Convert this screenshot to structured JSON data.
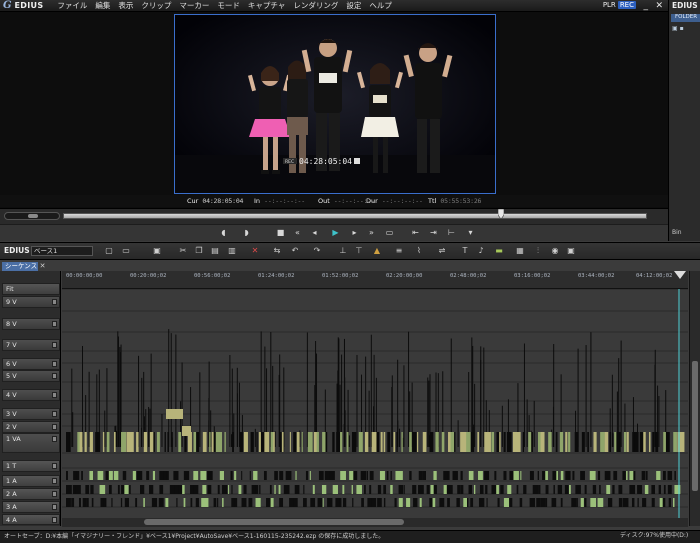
{
  "app": {
    "brand": "EDIUS",
    "logo_mark": "G"
  },
  "menu": [
    "ファイル",
    "編集",
    "表示",
    "クリップ",
    "マーカー",
    "モード",
    "キャプチャ",
    "レンダリング",
    "設定",
    "ヘルプ"
  ],
  "mode": {
    "plr": "PLR",
    "rec": "REC"
  },
  "window_controls": {
    "minimize": "_",
    "close": "✕"
  },
  "video_overlay": {
    "rec_label": "REC",
    "timecode": "04:28:05:04"
  },
  "timecodes": {
    "cur_label": "Cur",
    "cur_value": "04:28:05:04",
    "in_label": "In",
    "in_value": "--:--:--:--",
    "out_label": "Out",
    "out_value": "--:--:--:--",
    "dur_label": "Dur",
    "dur_value": "--:--:--:--",
    "ttl_label": "Ttl",
    "ttl_value": "05:55:53:26"
  },
  "bin": {
    "title": "EDIUS",
    "tab": "FOLDER",
    "bin_label": "Bin"
  },
  "timeline": {
    "brand": "EDIUS",
    "sequence_name": "ベース1",
    "sequence_tab": "シーケンス1",
    "ruler": [
      "00:00:00;00",
      "00:20:00;02",
      "00:56:00;02",
      "01:24:00;02",
      "01:52:00;02",
      "02:20:00;00",
      "02:48:00;02",
      "03:16:00;02",
      "03:44:00;02",
      "04:12:00;02"
    ],
    "track_headers": [
      {
        "label": "Fit",
        "kind": "zoom"
      },
      {
        "label": "9 V"
      },
      {
        "label": "8 V"
      },
      {
        "label": "7 V"
      },
      {
        "label": "6 V"
      },
      {
        "label": "5 V"
      },
      {
        "label": "4 V"
      },
      {
        "label": "3 V"
      },
      {
        "label": "2 V"
      },
      {
        "label": "1 VA"
      },
      {
        "label": "1 T"
      },
      {
        "label": "1 A"
      },
      {
        "label": "2 A"
      },
      {
        "label": "3 A"
      },
      {
        "label": "4 A"
      }
    ]
  },
  "status": {
    "message": "オートセーブ：D:¥本編「イマジナリー・フレンド」¥ベース1¥Project¥AutoSave¥ベース1-160115-235242.ezp の保存に成功しました。",
    "disk": "ディスク:97%使用中(D:)"
  },
  "colors": {
    "accent": "#3a6ecc",
    "play": "#3ec2c9",
    "clip": "#b8b47a",
    "audio_clip": "#9bc07a"
  }
}
